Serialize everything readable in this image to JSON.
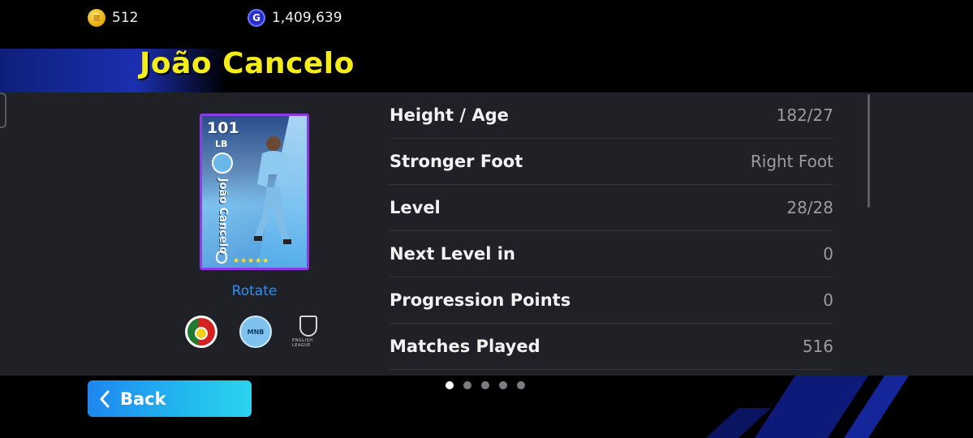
{
  "currency": {
    "coins": {
      "icon": "efootball-coin-icon",
      "value": "512"
    },
    "gp": {
      "icon": "gp-icon",
      "symbol": "G",
      "value": "1,409,639"
    }
  },
  "player": {
    "name": "João Cancelo",
    "card": {
      "rating": "101",
      "position": "LB",
      "name_vertical": "João Cancelo",
      "stars": "★★★★★"
    }
  },
  "actions": {
    "rotate_label": "Rotate",
    "back_label": "Back"
  },
  "emblems": [
    {
      "icon": "portugal-flag-icon"
    },
    {
      "icon": "club-badge-icon",
      "text": "MNB"
    },
    {
      "icon": "english-league-icon",
      "text": "ENGLISH LEAGUE"
    }
  ],
  "stats": [
    {
      "label": "Height / Age",
      "value": "182/27"
    },
    {
      "label": "Stronger Foot",
      "value": "Right Foot"
    },
    {
      "label": "Level",
      "value": "28/28"
    },
    {
      "label": "Next Level in",
      "value": "0"
    },
    {
      "label": "Progression Points",
      "value": "0"
    },
    {
      "label": "Matches Played",
      "value": "516"
    }
  ],
  "pager": {
    "pages": 5,
    "active_index": 0
  },
  "colors": {
    "title_yellow": "#f5ec1b",
    "link_blue": "#2d8ff0",
    "card_frame_purple": "#8a3de0",
    "panel_bg": "#1f2126"
  }
}
